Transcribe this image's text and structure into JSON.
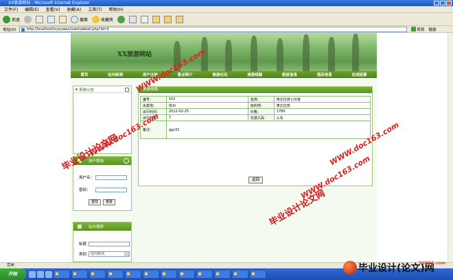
{
  "window": {
    "title": "XX旅游网站 - Microsoft Internet Explorer"
  },
  "menu": [
    "文件(F)",
    "编辑(E)",
    "查看(V)",
    "收藏(A)",
    "工具(T)",
    "帮助(H)"
  ],
  "toolbar": {
    "back_label": "后退",
    "search_label": "搜索",
    "favorites_label": "收藏夹"
  },
  "address": {
    "label": "地址(D)",
    "url": "http://localhost/lvyouwan/xianludetail.php?id=3",
    "go_label": "转到",
    "links_label": "链接"
  },
  "site": {
    "title": "XX旅游网站",
    "nav": [
      "首页",
      "站内新闻",
      "用户注册",
      "景点简介",
      "旅游论坛",
      "旅游线路",
      "航班信息",
      "酒店信息",
      "在线投票"
    ]
  },
  "sidebar": {
    "notice_title": "系统公告",
    "login_title": "用户登陆",
    "username_label": "用户名：",
    "password_label": "密码：",
    "login_button": "登陆",
    "reset_button": "重置",
    "search_title": "站内搜索",
    "search_title_label": "标题",
    "category_label": "类别",
    "category_value": "站内新闻"
  },
  "detail": {
    "panel_title": "旅游线路",
    "rows": [
      {
        "l1": "编号：",
        "v1": "102",
        "l2": "名称：",
        "v2": "奇达拉普七日游"
      },
      {
        "l1": "出发地：",
        "v1": "杭州",
        "l2": "目的地：",
        "v2": "奇达拉普"
      },
      {
        "l1": "出行时间：",
        "v1": "2012-02-25",
        "l2": "价格：",
        "v2": "1780"
      },
      {
        "l1": "出行时长：",
        "v1": "7",
        "l2": "交通工具：",
        "v2": "火车"
      }
    ],
    "remark_label": "备注：",
    "remark_value": "ggs32",
    "back_button": "返回"
  },
  "statusbar": {
    "text": "完毕"
  },
  "taskbar": {
    "start_label": "开始"
  },
  "watermarks": {
    "cn": "毕业设计论文网",
    "url": "WWW.doc163.com",
    "logo_text": "毕业设计(论文)网",
    "logo_url": "56DOC.com"
  }
}
